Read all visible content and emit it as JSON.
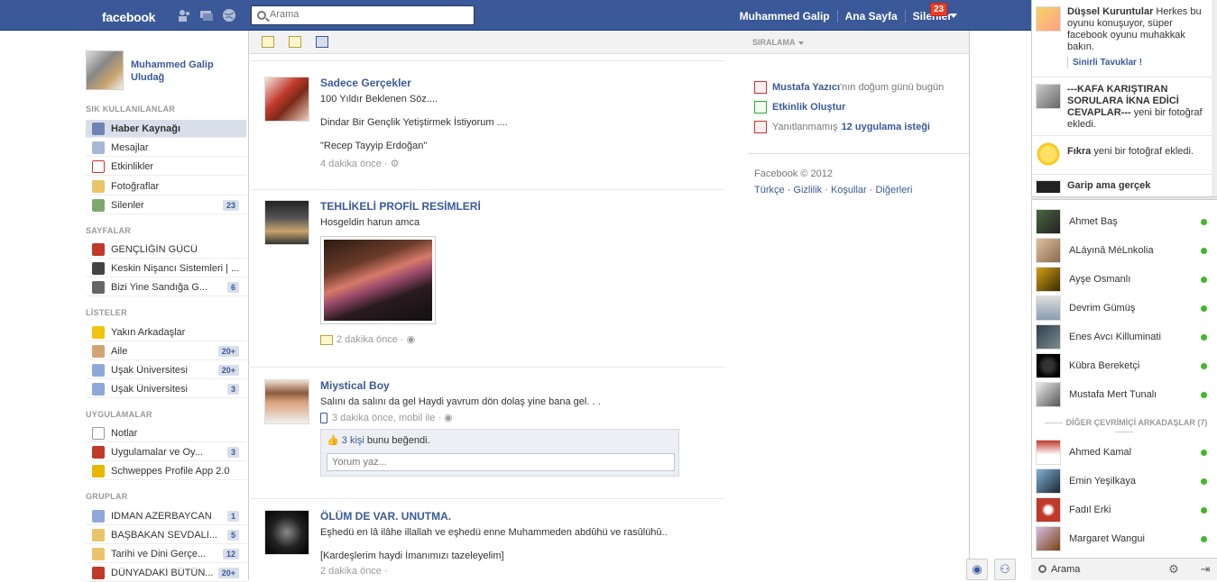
{
  "topbar": {
    "logo": "facebook",
    "search_placeholder": "Arama",
    "nav": [
      "Muhammed Galip",
      "Ana Sayfa",
      "Silenler"
    ],
    "notif_count": "23"
  },
  "profile": {
    "name": "Muhammed Galip Uludağ"
  },
  "sections": {
    "favorites": "SIK KULLANILANLAR",
    "pages": "SAYFALAR",
    "lists": "LİSTELER",
    "apps": "UYGULAMALAR",
    "groups": "GRUPLAR"
  },
  "nav": {
    "favorites": [
      {
        "label": "Haber Kaynağı",
        "count": "",
        "icon": "news-feed-icon"
      },
      {
        "label": "Mesajlar",
        "count": "",
        "icon": "messages-icon"
      },
      {
        "label": "Etkinlikler",
        "count": "",
        "icon": "events-icon"
      },
      {
        "label": "Fotoğraflar",
        "count": "",
        "icon": "photos-icon"
      },
      {
        "label": "Silenler",
        "count": "23",
        "icon": "friends-icon"
      }
    ],
    "pages": [
      {
        "label": "GENÇLİĞİN GÜCÜ",
        "count": ""
      },
      {
        "label": "Keskin Nişancı Sistemleri | ...",
        "count": ""
      },
      {
        "label": "Bizi Yine Sandığa G...",
        "count": "6"
      }
    ],
    "lists": [
      {
        "label": "Yakın Arkadaşlar",
        "count": ""
      },
      {
        "label": "Aile",
        "count": "20+"
      },
      {
        "label": "Uşak Üniversitesi",
        "count": "20+"
      },
      {
        "label": "Uşak Üniversitesi",
        "count": "3"
      }
    ],
    "apps": [
      {
        "label": "Notlar",
        "count": ""
      },
      {
        "label": "Uygulamalar ve Oy...",
        "count": "3"
      },
      {
        "label": "Schweppes Profile App 2.0",
        "count": ""
      }
    ],
    "groups": [
      {
        "label": "IDMAN AZERBAYCAN",
        "count": "1"
      },
      {
        "label": "BAŞBAKAN SEVDALI...",
        "count": "5"
      },
      {
        "label": "Tarihi ve Dini Gerçe...",
        "count": "12"
      },
      {
        "label": "DÜNYADAKİ BÜTÜN...",
        "count": "20+"
      }
    ]
  },
  "composer": {
    "sort_label": "SIRALAMA"
  },
  "feed": [
    {
      "actor": "Sadece Gerçekler",
      "lines": [
        "100 Yıldır Beklenen Söz....",
        "Dindar Bir Gençlik Yetiştirmek İstiyorum ....",
        "\"Recep Tayyip Erdoğan\""
      ],
      "meta": "4 dakika önce ·"
    },
    {
      "actor": "TEHLİKELİ PROFİL RESİMLERİ",
      "lines": [
        "Hosgeldin harun amca"
      ],
      "meta": "2 dakika önce ·"
    },
    {
      "actor": "Miystical Boy",
      "lines": [
        "Salını da salını da gel Haydi yavrum dön dolaş yine bana gel. . ."
      ],
      "meta": "3 dakika önce, mobil ile ·",
      "likes_count": "3 kişi",
      "likes_text": "bunu beğendi.",
      "comment_placeholder": "Yorum yaz..."
    },
    {
      "actor": "ÖLÜM DE VAR. UNUTMA.",
      "lines": [
        "Eşhedü en lâ ilâhe illallah ve eşhedü enne Muhammeden abdûhü ve rasûlühû..",
        "[Kardeşlerim haydi İmanımızı tazeleyelim]"
      ],
      "meta": "2 dakika önce ·"
    }
  ],
  "right": {
    "birthday_name": "Mustafa Yazıcı",
    "birthday_text": "'nın doğum günü bugün",
    "create_event": "Etkinlik Oluştur",
    "requests_prefix": "Yanıtlanmamış",
    "requests_link": "12 uygulama isteği",
    "footer_copy": "Facebook © 2012",
    "footer_links": "Türkçe · Gizlilik · Koşullar · Diğerleri"
  },
  "ticker": [
    {
      "actor": "Düşsel Kuruntular",
      "text": "Herkes bu oyunu konuşuyor, süper facebook oyunu muhakkak bakın.",
      "sub": "Sinirli Tavuklar !"
    },
    {
      "actor": "---KAFA KARIŞTIRAN SORULARA İKNA EDİCİ CEVAPLAR---",
      "text": "yeni bir fotoğraf ekledi."
    },
    {
      "actor": "Fıkra",
      "text": "yeni bir fotoğraf ekledi."
    },
    {
      "actor": "Garip ama gerçek",
      "text": ""
    }
  ],
  "chat": {
    "online": [
      "Ahmet Baş",
      "ALáyınâ MéLnkolia",
      "Ayşe Osmanlı",
      "Devrim Gümüş",
      "Enes Avcı Killuminati",
      "Kübra Bereketçi",
      "Mustafa Mert Tunalı"
    ],
    "other_heading": "DİĞER ÇEVRİMİÇİ ARKADAŞLAR (7)",
    "other": [
      "Ahmed Kamal",
      "Emin Yeşilkaya",
      "Fadıl Erki",
      "Margaret Wangui"
    ],
    "search_label": "Arama"
  },
  "colors": {
    "brand": "#3b5998",
    "online": "#42b72a",
    "badge": "#f03d25"
  }
}
